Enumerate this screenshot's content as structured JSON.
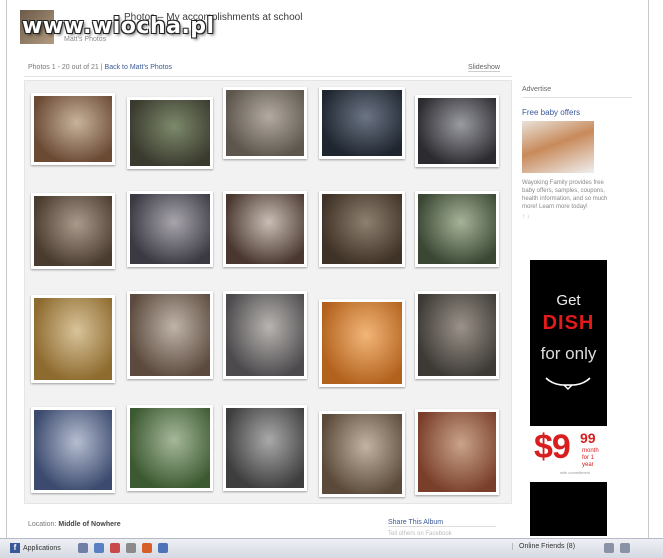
{
  "watermark": {
    "text": "www.wiocha.pl"
  },
  "header": {
    "album_title": "Photos – My accomplishments at school",
    "owner": "Matt's Photos"
  },
  "breadcrumb": {
    "count_text": "Photos 1 - 20 out of 21",
    "separator": " | ",
    "back_link": "Back to Matt's Photos"
  },
  "view_toggle": {
    "label": "Slideshow"
  },
  "photos": [
    {
      "c1": "#6b4a34",
      "c2": "#c8b39b"
    },
    {
      "c1": "#3a3a2e",
      "c2": "#7d8a6b"
    },
    {
      "c1": "#5d564c",
      "c2": "#b3aba1"
    },
    {
      "c1": "#1f2630",
      "c2": "#6c7585"
    },
    {
      "c1": "#2c2c30",
      "c2": "#9a9aa2"
    },
    {
      "c1": "#4a3b2f",
      "c2": "#a99a8c"
    },
    {
      "c1": "#3b3a42",
      "c2": "#a8a5ad"
    },
    {
      "c1": "#4a3830",
      "c2": "#c8bdb4"
    },
    {
      "c1": "#3f3226",
      "c2": "#8e8070"
    },
    {
      "c1": "#3a4733",
      "c2": "#a7b398"
    },
    {
      "c1": "#8d6a2d",
      "c2": "#d8c39a"
    },
    {
      "c1": "#5c4a3e",
      "c2": "#bfb3a8"
    },
    {
      "c1": "#4c4a4d",
      "c2": "#b8b4b0"
    },
    {
      "c1": "#b3621e",
      "c2": "#f2b678"
    },
    {
      "c1": "#3d3a36",
      "c2": "#9b9289"
    },
    {
      "c1": "#3b4a6e",
      "c2": "#b5bdd0"
    },
    {
      "c1": "#3c5a32",
      "c2": "#a6b89a"
    },
    {
      "c1": "#3e3e3e",
      "c2": "#a9a9a9"
    },
    {
      "c1": "#5b4a3a",
      "c2": "#c2b3a2"
    },
    {
      "c1": "#7a3f2a",
      "c2": "#c9a38a"
    }
  ],
  "sidebar": {
    "heading": "Advertise",
    "ad_title": "Free baby offers",
    "ad_text": "Wayoking Family provides free baby offers, samples, coupons, health information, and so much more! Learn more today!",
    "ad_like": "↑ ↓"
  },
  "dish_ad": {
    "line1": "Get",
    "brand": "DISH",
    "line2": "for only",
    "price": "$9",
    "cents": "99",
    "per": "month",
    "per2": "for 1 year",
    "fine": "with commitment"
  },
  "footer": {
    "location_label": "Location:",
    "location_value": "Middle of Nowhere",
    "share_label": "Share This Album",
    "share_sub": "Tell others on Facebook"
  },
  "taskbar": {
    "apps_label": "Applications",
    "online_label": "Online Friends (8)"
  },
  "colors": {
    "fb_blue": "#3b5998",
    "dish_red": "#e11a1a"
  }
}
